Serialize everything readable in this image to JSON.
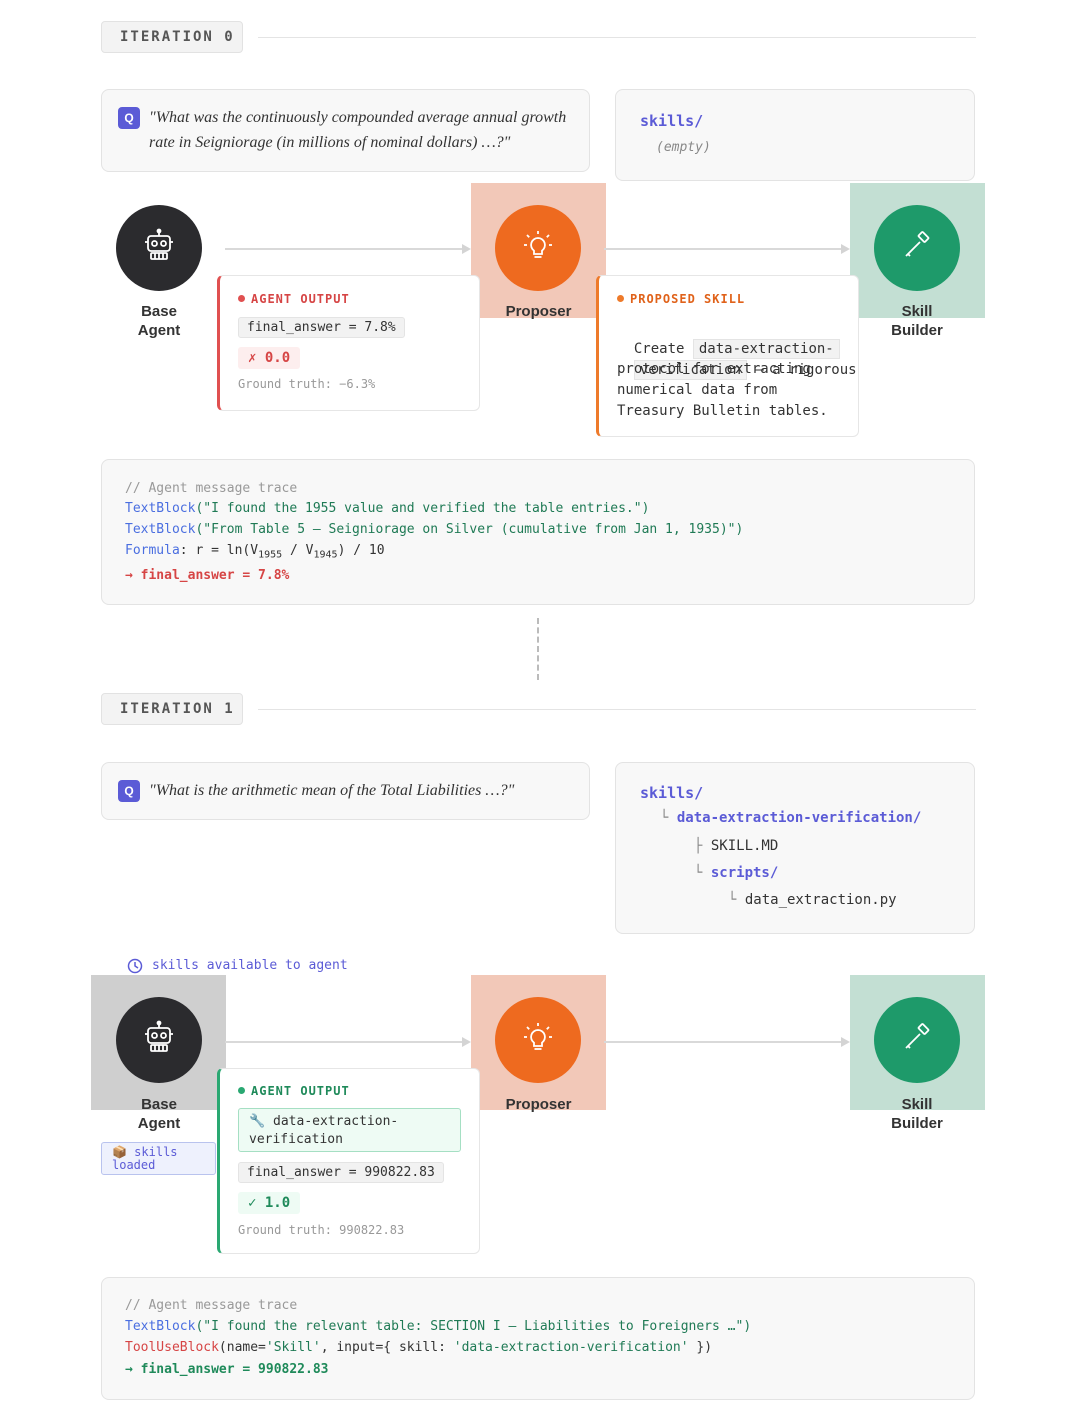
{
  "iteration0": {
    "label": "ITERATION 0",
    "question": "\"What was the continuously compounded average annual growth rate in Seigniorage (in millions of nominal dollars) …?\"",
    "question_badge": "Q",
    "skills": {
      "root": "skills/",
      "empty": "(empty)"
    },
    "nodes": {
      "base_agent": "Base\nAgent",
      "proposer": "Proposer",
      "skill_builder": "Skill\nBuilder"
    },
    "agent_output": {
      "header": "AGENT OUTPUT",
      "final_answer": "final_answer = 7.8%",
      "score": "✗ 0.0",
      "ground_truth": "Ground truth: −6.3%"
    },
    "proposed_skill": {
      "header": "PROPOSED SKILL",
      "text_pre": "Create ",
      "skill_name_1": "data-extraction-",
      "skill_name_2": "verification",
      "text_post_1": " — a rigorous",
      "text_post_2": "protocol for extracting",
      "text_post_3": "numerical data from",
      "text_post_4": "Treasury Bulletin tables."
    },
    "trace": {
      "comment": "// Agent message trace",
      "line1_fn": "TextBlock",
      "line1_arg": "(\"I found the 1955 value and verified the table entries.\")",
      "line2_fn": "TextBlock",
      "line2_arg": "(\"From Table 5 — Seigniorage on Silver (cumulative from Jan 1, 1935)\")",
      "line3_fn": "Formula",
      "line3_a": ": r = ln(V",
      "line3_sub1": "1955",
      "line3_b": " / V",
      "line3_sub2": "1945",
      "line3_c": ") / 10",
      "line4": "→ final_answer = 7.8%"
    }
  },
  "iteration1": {
    "label": "ITERATION 1",
    "question": "\"What is the arithmetic mean of the Total Liabilities …?\"",
    "question_badge": "Q",
    "skills": {
      "root": "skills/",
      "dir": "data-extraction-verification/",
      "file1": "SKILL.MD",
      "subdir": "scripts/",
      "file2": "data_extraction.py"
    },
    "skills_available": "skills available to agent",
    "skills_loaded": "📦 skills loaded",
    "nodes": {
      "base_agent": "Base\nAgent",
      "proposer": "Proposer",
      "skill_builder": "Skill\nBuilder"
    },
    "agent_output": {
      "header": "AGENT OUTPUT",
      "skill_chip": "🔧 data-extraction-\nverification",
      "final_answer": "final_answer = 990822.83",
      "score": "✓ 1.0",
      "ground_truth": "Ground truth: 990822.83"
    },
    "trace": {
      "comment": "// Agent message trace",
      "line1_fn": "TextBlock",
      "line1_arg": "(\"I found the relevant table: SECTION I — Liabilities to Foreigners …\")",
      "line2_fn": "ToolUseBlock",
      "line2_a": "(name=",
      "line2_s1": "'Skill'",
      "line2_b": ", input={ skill: ",
      "line2_s2": "'data-extraction-verification'",
      "line2_c": " })",
      "line3": "→ final_answer = 990822.83"
    }
  },
  "colors": {
    "accent": "#5b5bd6",
    "agent_dark": "#2b2b2e",
    "proposer_orange": "#ee6a1f",
    "builder_green": "#1e9a6a",
    "fail_red": "#d64545",
    "pass_green": "#1f8a5a"
  },
  "icons": {
    "base_agent": "robot-icon",
    "proposer": "lightbulb-icon",
    "skill_builder": "hammer-icon",
    "clock": "clock-icon"
  }
}
